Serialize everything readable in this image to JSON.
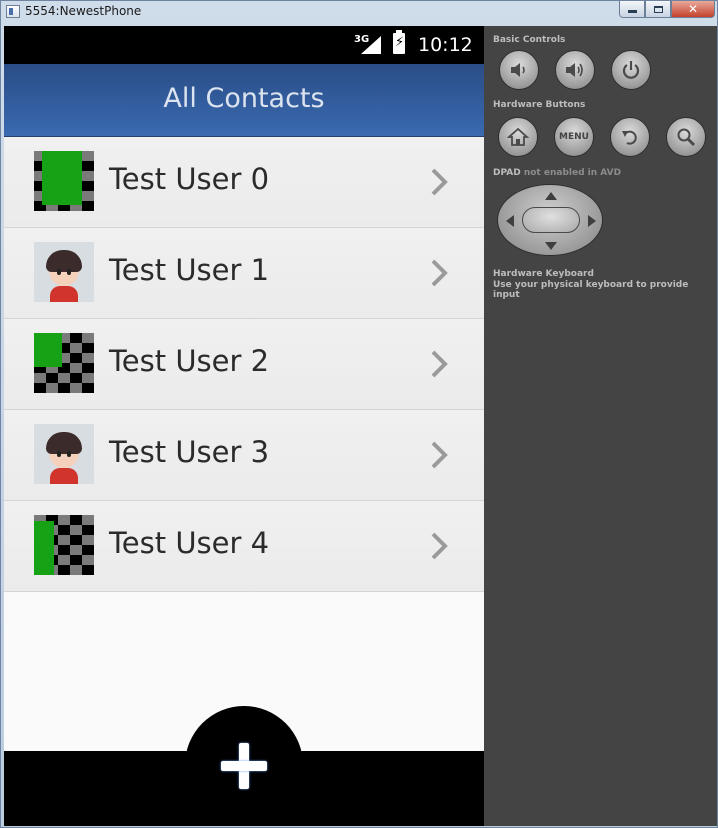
{
  "window": {
    "title": "5554:NewestPhone"
  },
  "status_bar": {
    "network": "3G",
    "time": "10:12"
  },
  "action_bar": {
    "title": "All Contacts"
  },
  "contacts": [
    {
      "name": "Test User 0",
      "avatar": "checker-green"
    },
    {
      "name": "Test User 1",
      "avatar": "cartoon-boy"
    },
    {
      "name": "Test User 2",
      "avatar": "checker-green"
    },
    {
      "name": "Test User 3",
      "avatar": "cartoon-boy"
    },
    {
      "name": "Test User 4",
      "avatar": "checker-green"
    }
  ],
  "fab": {
    "icon": "plus-icon"
  },
  "controls": {
    "basic_controls_label": "Basic Controls",
    "basic_buttons": [
      "volume-down-icon",
      "volume-up-icon",
      "power-icon"
    ],
    "hardware_buttons_label": "Hardware Buttons",
    "hardware_buttons": [
      "home-icon",
      "menu-button",
      "back-icon",
      "search-icon"
    ],
    "menu_label": "MENU",
    "dpad_label_strong": "DPAD",
    "dpad_label_dim": "not enabled in AVD",
    "keyboard_label": "Hardware Keyboard",
    "keyboard_hint": "Use your physical keyboard to provide input"
  },
  "colors": {
    "action_bar": "#3a6ab1",
    "avatar_green": "#17a115",
    "control_panel": "#444444"
  }
}
